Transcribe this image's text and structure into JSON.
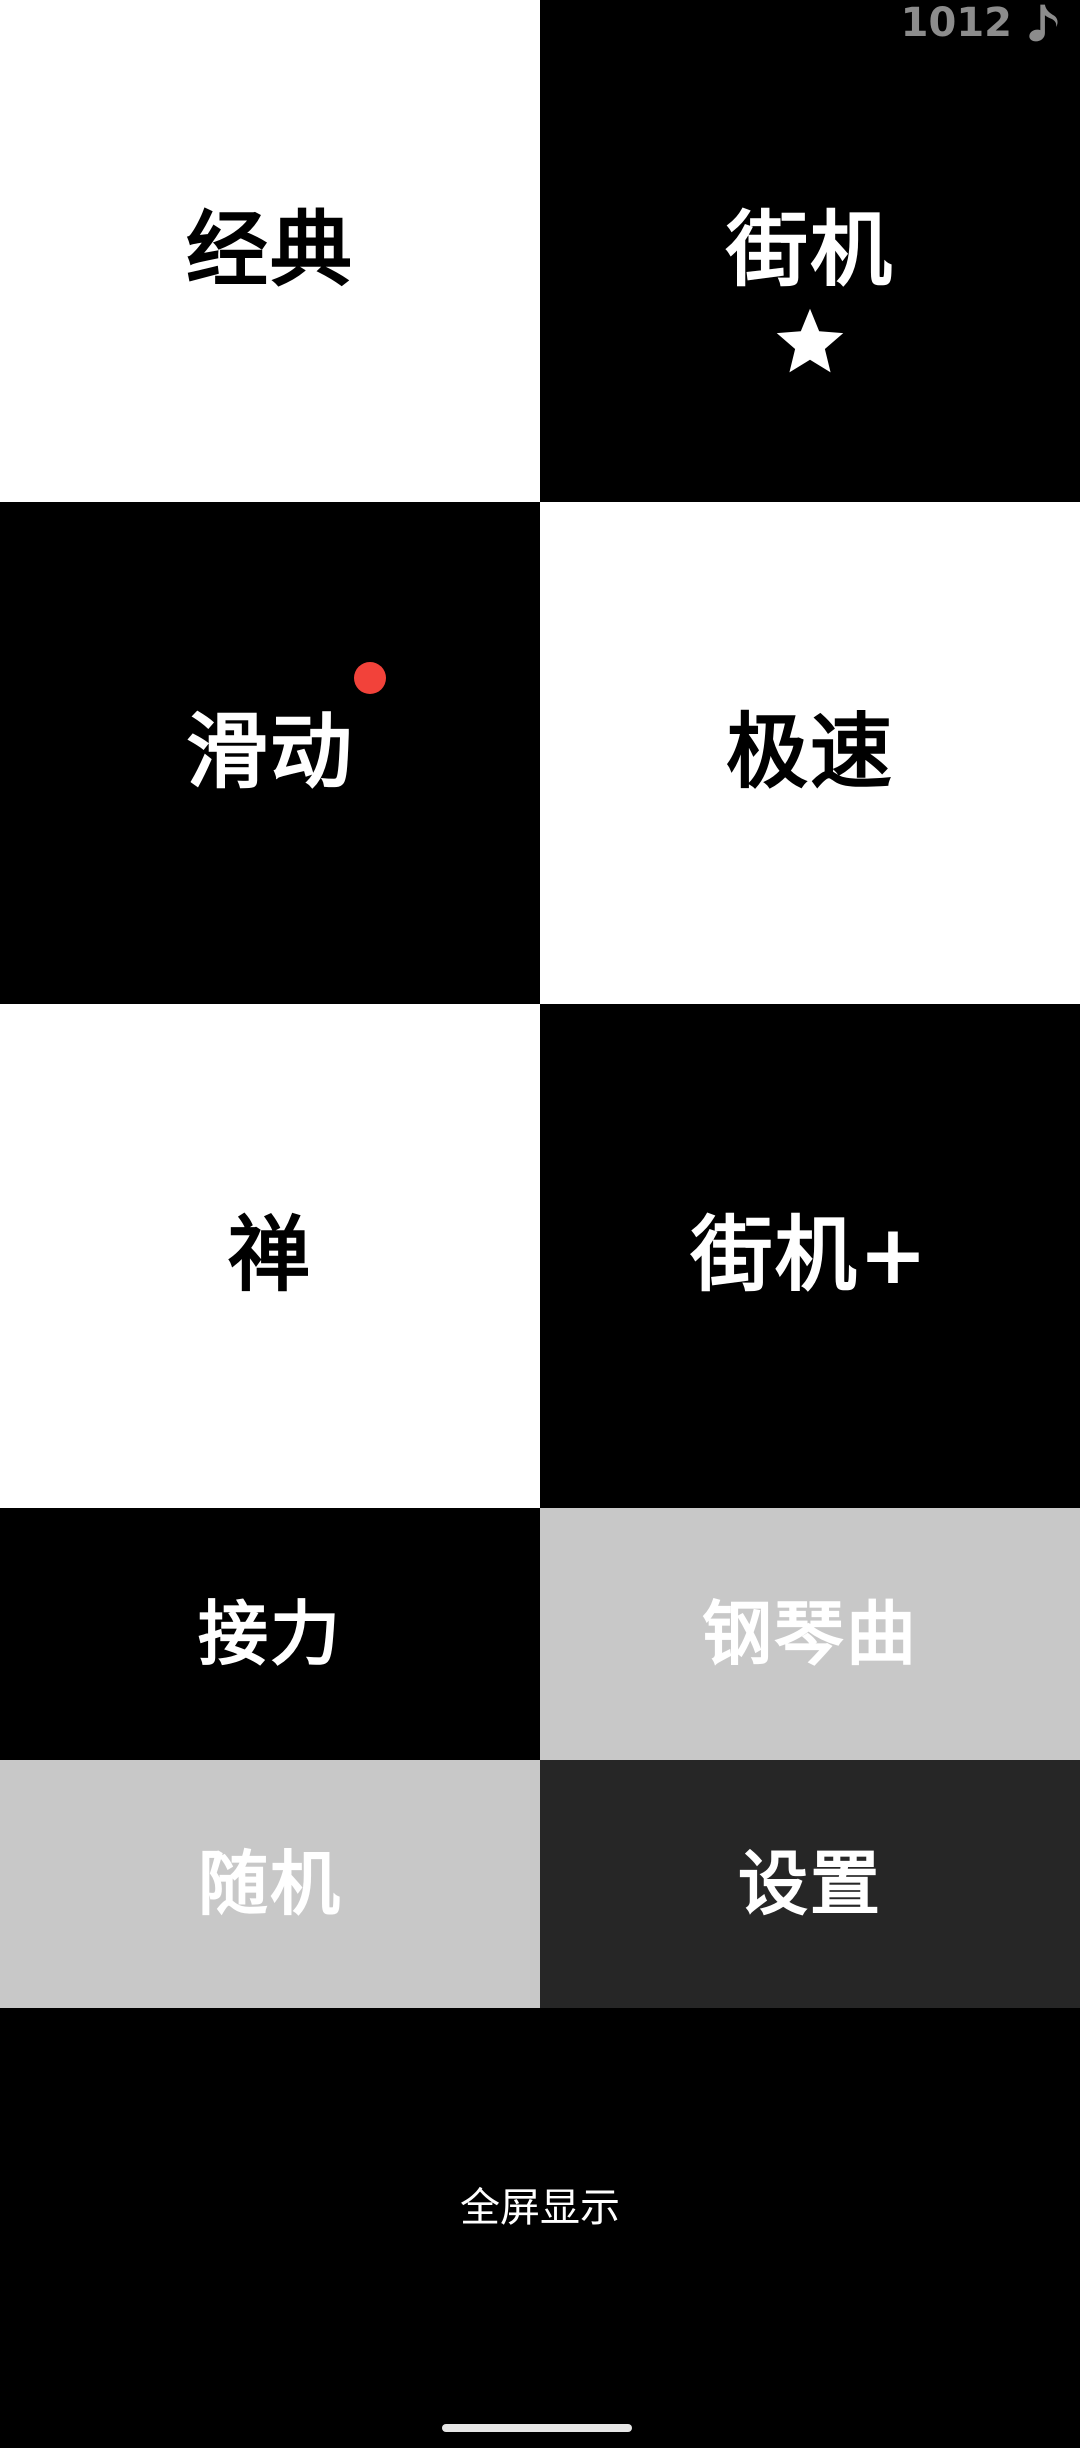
{
  "score": {
    "value": "1012",
    "icon": "music-note-icon"
  },
  "modes": {
    "classic": "经典",
    "arcade": "街机",
    "slide": "滑动",
    "speed": "极速",
    "zen": "禅",
    "arcade_plus": "街机+",
    "relay": "接力",
    "piano_songs": "钢琴曲",
    "random": "随机",
    "settings": "设置"
  },
  "badges": {
    "arcade_star": "star-icon",
    "slide_new": "notification-dot"
  },
  "footer": {
    "fullscreen_label": "全屏显示"
  },
  "colors": {
    "tile_white": "#ffffff",
    "tile_black": "#000000",
    "tile_gray": "#c8c8c8",
    "tile_dark": "#262626",
    "notification_dot": "#f2423a",
    "counter_text": "#8c8c8c"
  }
}
